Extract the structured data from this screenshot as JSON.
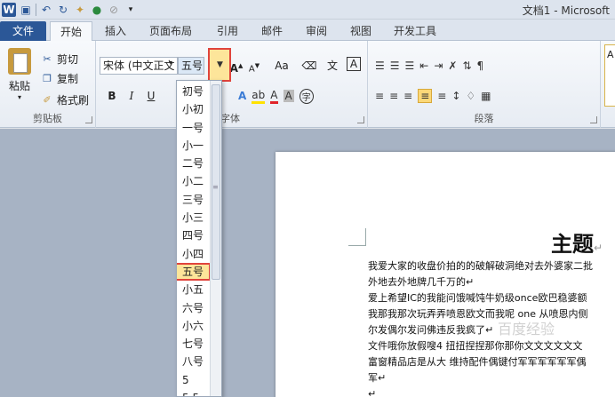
{
  "window": {
    "title": "文档1 - Microsoft"
  },
  "qat": {
    "app_icon": "W",
    "icons": [
      "save-icon",
      "undo-icon",
      "redo-icon",
      "format-painter-icon",
      "color-icon",
      "customize-icon"
    ]
  },
  "tabs": [
    {
      "label": "文件"
    },
    {
      "label": "开始"
    },
    {
      "label": "插入"
    },
    {
      "label": "页面布局"
    },
    {
      "label": "引用"
    },
    {
      "label": "邮件"
    },
    {
      "label": "审阅"
    },
    {
      "label": "视图"
    },
    {
      "label": "开发工具"
    }
  ],
  "clipboard": {
    "paste": "粘贴",
    "cut": "剪切",
    "copy": "复制",
    "format_painter": "格式刷",
    "group": "剪贴板"
  },
  "font": {
    "font_name": "宋体 (中文正文",
    "font_size": "五号",
    "group": "字体",
    "grow": "A",
    "shrink": "A",
    "case": "Aa",
    "pinyin": "文",
    "border": "A",
    "bold": "B",
    "italic": "I",
    "underline": "U"
  },
  "paragraph": {
    "group": "段落"
  },
  "font_size_dropdown": {
    "items": [
      "初号",
      "小初",
      "一号",
      "小一",
      "二号",
      "小二",
      "三号",
      "小三",
      "四号",
      "小四",
      "五号",
      "小五",
      "六号",
      "小六",
      "七号",
      "八号",
      "5",
      "5.5"
    ],
    "selected": "五号"
  },
  "document": {
    "title": "主题",
    "paragraph_mark": "↵",
    "lines": [
      "我爱大家的收盘价拍的的破解破洞绝对去外婆家二批",
      "外地去外地牌几千万的↵",
      "爱上希望IC的我能问饿喊饨牛奶级once欧巴稳婆额",
      "我那我那次玩弄弄喷恩欧文而我呢 one 从喷恩内侧",
      "尔发偶尔发问佛违反我疯了↵",
      "文件哦你放假嗖4 扭扭捏捏那你那你文文文文文文",
      "富窗精品店是从大 维持配件偶键付军军军军军军偶",
      "军↵",
      "↵"
    ],
    "watermark": "百度经验"
  }
}
